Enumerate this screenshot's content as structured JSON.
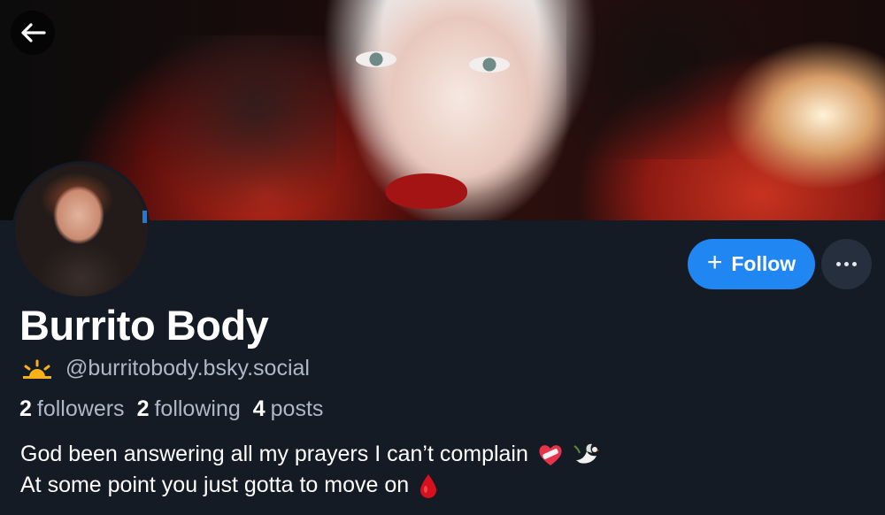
{
  "profile": {
    "display_name": "Burrito Body",
    "handle": "@burritobody.bsky.social",
    "handle_emoji_icon": "sunrise-icon",
    "stats": {
      "followers_count": "2",
      "followers_label": "followers",
      "following_count": "2",
      "following_label": "following",
      "posts_count": "4",
      "posts_label": "posts"
    },
    "bio_lines": [
      "God been answering all my prayers I can’t complain",
      "At some point you just gotta to move on"
    ],
    "bio_line1_icons": [
      "mending-heart-icon",
      "dove-icon"
    ],
    "bio_line2_icons": [
      "blood-drop-icon"
    ]
  },
  "actions": {
    "follow_label": "Follow",
    "follow_icon": "plus-icon",
    "more_icon": "more-dots-icon",
    "back_icon": "arrow-left-icon"
  },
  "colors": {
    "background": "#151b24",
    "accent": "#1f86f2",
    "secondary_text": "#aeb8c6",
    "more_button": "#262f3d"
  }
}
